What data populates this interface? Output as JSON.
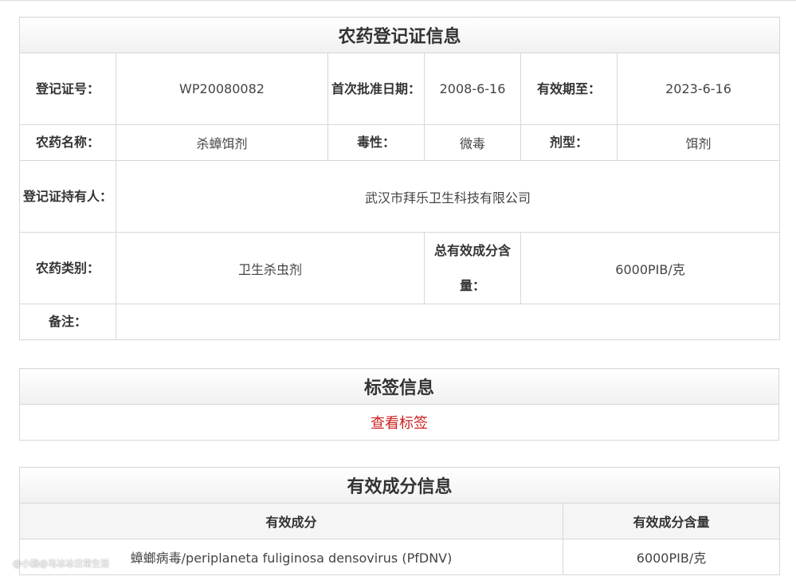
{
  "registration": {
    "title": "农药登记证信息",
    "rows": {
      "reg_no_label": "登记证号：",
      "reg_no": "WP20080082",
      "first_date_label": "首次批准日期：",
      "first_date": "2008-6-16",
      "valid_label": "有效期至：",
      "valid_until": "2023-6-16",
      "name_label": "农药名称：",
      "name": "杀蟑饵剂",
      "toxicity_label": "毒性：",
      "toxicity": "微毒",
      "formulation_label": "剂型：",
      "formulation": "饵剂",
      "holder_label": "登记证持有人：",
      "holder": "武汉市拜乐卫生科技有限公司",
      "category_label": "农药类别：",
      "category": "卫生杀虫剂",
      "total_content_label": "总有效成分含量：",
      "total_content": "6000PIB/克",
      "remarks_label": "备注：",
      "remarks": ""
    }
  },
  "label_info": {
    "title": "标签信息",
    "view_link": "查看标签"
  },
  "ingredients": {
    "title": "有效成分信息",
    "headers": [
      "有效成分",
      "有效成分含量"
    ],
    "rows": [
      {
        "name": "蟑螂病毒/periplaneta fuliginosa densovirus (PfDNV)",
        "content": "6000PIB/克"
      }
    ]
  },
  "watermark": "@小赖@马冰冰日常生活"
}
